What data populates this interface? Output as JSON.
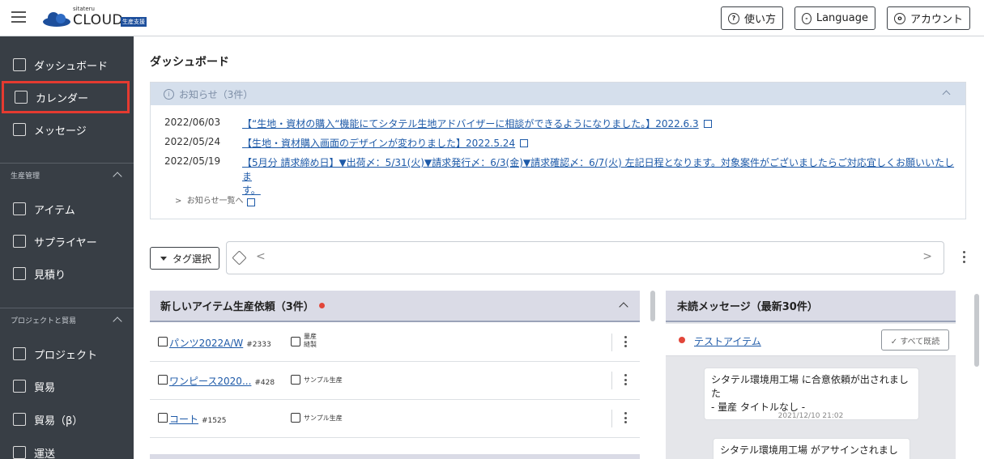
{
  "header": {
    "logo_small": "sitateru",
    "logo_main": "CLOUD",
    "logo_badge": "生産支援",
    "buttons": [
      {
        "label": "使い方",
        "icon": "help-icon"
      },
      {
        "label": "Language",
        "icon": "globe-icon"
      },
      {
        "label": "アカウント",
        "icon": "account-icon"
      }
    ]
  },
  "sidebar": {
    "top_items": [
      {
        "label": "ダッシュボード",
        "icon": "dashboard-icon"
      },
      {
        "label": "カレンダー",
        "icon": "calendar-icon"
      },
      {
        "label": "メッセージ",
        "icon": "message-icon"
      }
    ],
    "section1": {
      "title": "生産管理",
      "items": [
        {
          "label": "アイテム",
          "icon": "list-icon"
        },
        {
          "label": "サプライヤー",
          "icon": "building-icon"
        },
        {
          "label": "見積り",
          "icon": "estimate-icon"
        }
      ]
    },
    "section2": {
      "title": "プロジェクトと貿易",
      "items": [
        {
          "label": "プロジェクト",
          "icon": "thumbs-up-icon"
        },
        {
          "label": "貿易",
          "icon": "ship-icon"
        },
        {
          "label": "貿易（β）",
          "icon": "ship-icon"
        },
        {
          "label": "運送",
          "icon": "transport-icon"
        }
      ]
    }
  },
  "main": {
    "title": "ダッシュボード",
    "notice": {
      "header": "お知らせ（3件）",
      "items": [
        {
          "date": "2022/06/03",
          "text": "【“生地・資材の購入“機能にてシタテル生地アドバイザーに相談ができるようになりました。】2022.6.3"
        },
        {
          "date": "2022/05/24",
          "text": "【生地・資材購入画面のデザインが変わりました】2022.5.24"
        },
        {
          "date": "2022/05/19",
          "text_line1": "【5月分 請求締め日】▼出荷〆：5/31(火)▼請求発行〆：6/3(金)▼請求確認〆：6/7(火) 左記日程となります。対象案件がございましたらご対応宜しくお願いいたし",
          "text_line2": "ます。"
        }
      ],
      "more": "お知らせ一覧へ"
    },
    "tag_select": "タグ選択",
    "items_panel": {
      "title": "新しいアイテム生産依頼（3件）",
      "rows": [
        {
          "name": "パンツ2022A/W",
          "id": "#2333",
          "type_line1": "量産",
          "type_line2": "縫製"
        },
        {
          "name": "ワンピース2020...",
          "id": "#428",
          "type_line1": "サンプル生産",
          "type_line2": ""
        },
        {
          "name": "コート",
          "id": "#1525",
          "type_line1": "サンプル生産",
          "type_line2": ""
        }
      ]
    },
    "messages_panel": {
      "title": "未読メッセージ（最新30件）",
      "item_name": "テストアイテム",
      "read_all": "✓ すべて既読",
      "bubble1_line1": "シタテル環境用工場 に合意依頼が出されました",
      "bubble1_line2": "- 量産 タイトルなし -",
      "time1": "2021/12/10 21:02",
      "bubble2_line1": "シタテル環境用工場 がアサインされました"
    }
  }
}
